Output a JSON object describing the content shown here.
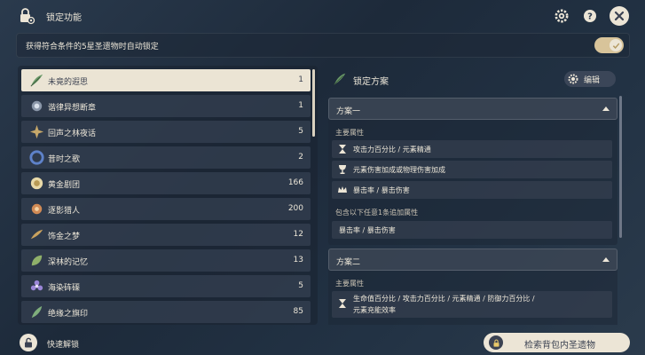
{
  "window": {
    "title": "锁定功能"
  },
  "toggle": {
    "label": "获得符合条件的5星圣遗物时自动锁定",
    "on": true
  },
  "sets": [
    {
      "name": "未竟的遐思",
      "count": "1",
      "selected": true,
      "icon": "green-feather-icon"
    },
    {
      "name": "谐律异想断章",
      "count": "1",
      "icon": "crystal-mask-icon"
    },
    {
      "name": "回声之林夜话",
      "count": "5",
      "icon": "night-flower-icon"
    },
    {
      "name": "昔时之歌",
      "count": "2",
      "icon": "blue-wreath-icon"
    },
    {
      "name": "黄金剧团",
      "count": "166",
      "icon": "gold-medal-icon"
    },
    {
      "name": "逐影猎人",
      "count": "200",
      "icon": "orange-flower-icon"
    },
    {
      "name": "饰金之梦",
      "count": "12",
      "icon": "gold-feather-icon"
    },
    {
      "name": "深林的记忆",
      "count": "13",
      "icon": "green-leaf-icon"
    },
    {
      "name": "海染砗磲",
      "count": "5",
      "icon": "purple-flower-icon"
    },
    {
      "name": "绝缘之旗印",
      "count": "85",
      "icon": "green-plume-icon"
    }
  ],
  "right": {
    "title": "锁定方案",
    "edit_label": "编辑",
    "scheme1": {
      "label": "方案一",
      "main_label": "主要属性",
      "main_stats": [
        {
          "icon": "hourglass-icon",
          "text": "攻击力百分比 / 元素精通"
        },
        {
          "icon": "goblet-icon",
          "text": "元素伤害加成或物理伤害加成"
        },
        {
          "icon": "crown-icon",
          "text": "暴击率 / 暴击伤害"
        }
      ],
      "sub_label": "包含以下任意1条追加属性",
      "sub_stats": [
        {
          "text": "暴击率 / 暴击伤害"
        }
      ]
    },
    "scheme2": {
      "label": "方案二",
      "main_label": "主要属性",
      "main_stats": [
        {
          "icon": "hourglass-icon",
          "text": "生命值百分比 / 攻击力百分比 / 元素精通 / 防御力百分比 /",
          "text2": "元素充能效率"
        }
      ]
    }
  },
  "bottom": {
    "unlock_label": "快速解锁",
    "search_label": "检索背包内圣遗物"
  },
  "colors": {
    "accent": "#ebe4d4",
    "toggle_on": "#d8c49a",
    "dark_text": "#3d4352"
  }
}
